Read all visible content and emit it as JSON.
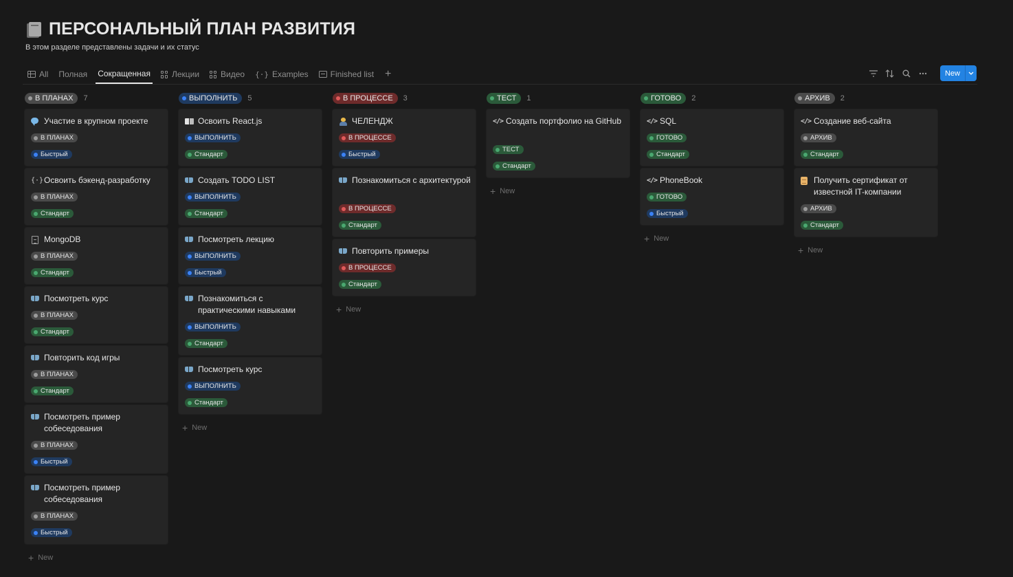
{
  "page": {
    "title": "ПЕРСОНАЛЬНЫЙ ПЛАН РАЗВИТИЯ",
    "subtitle": "В этом разделе представлены задачи и их статус",
    "icon": "books-icon"
  },
  "tabs": [
    {
      "label": "All",
      "icon": "table-icon"
    },
    {
      "label": "Полная",
      "icon": "board-icon"
    },
    {
      "label": "Сокращенная",
      "icon": "board-icon",
      "active": true
    },
    {
      "label": "Лекции",
      "icon": "gallery-icon"
    },
    {
      "label": "Видео",
      "icon": "gallery-icon"
    },
    {
      "label": "Examples",
      "icon": "braces-icon"
    },
    {
      "label": "Finished list",
      "icon": "list-icon"
    }
  ],
  "toolbar": {
    "new_label": "New",
    "icons": [
      "filter-icon",
      "sort-icon",
      "search-icon",
      "more-icon",
      "chevron-down-icon"
    ]
  },
  "colors": {
    "background": "#191919",
    "card": "#252525",
    "accent": "#2383e2",
    "gray_tag": "#4a4a4a",
    "blue_tag": "#1f3a5f",
    "red_tag": "#6e2b2b",
    "green_tag": "#2b5a3a",
    "gray_dot": "#9b9b9b",
    "blue_dot": "#3b82f6",
    "red_dot": "#e05a5a",
    "green_dot": "#4aa870"
  },
  "add_new_label": "New",
  "columns": [
    {
      "status": "В ПЛАНАХ",
      "count": "7",
      "color": "gray",
      "cards": [
        {
          "title": "Участие в крупном проекте",
          "icon": "chat-icon",
          "status": "В ПЛАНАХ",
          "speed": "Быстрый"
        },
        {
          "title": "Освоить бэкенд-разработку",
          "icon": "braces-icon",
          "status": "В ПЛАНАХ",
          "speed": "Стандарт"
        },
        {
          "title": "MongoDB",
          "icon": "document-icon",
          "status": "В ПЛАНАХ",
          "speed": "Стандарт"
        },
        {
          "title": "Посмотреть курс",
          "icon": "book-icon",
          "status": "В ПЛАНАХ",
          "speed": "Стандарт"
        },
        {
          "title": "Повторить код игры",
          "icon": "book-icon",
          "status": "В ПЛАНАХ",
          "speed": "Стандарт"
        },
        {
          "title": "Посмотреть пример собеседования",
          "icon": "book-icon",
          "status": "В ПЛАНАХ",
          "speed": "Быстрый"
        },
        {
          "title": "Посмотреть пример собеседования",
          "icon": "book-icon",
          "status": "В ПЛАНАХ",
          "speed": "Быстрый"
        }
      ]
    },
    {
      "status": "ВЫПОЛНИТЬ",
      "count": "5",
      "color": "blue",
      "cards": [
        {
          "title": "Освоить React.js",
          "icon": "open-book-icon",
          "status": "ВЫПОЛНИТЬ",
          "speed": "Стандарт"
        },
        {
          "title": "Создать TODO LIST",
          "icon": "book-icon",
          "status": "ВЫПОЛНИТЬ",
          "speed": "Стандарт"
        },
        {
          "title": "Посмотреть лекцию",
          "icon": "book-icon",
          "status": "ВЫПОЛНИТЬ",
          "speed": "Быстрый"
        },
        {
          "title": "Познакомиться с практическими навыками",
          "icon": "book-icon",
          "status": "ВЫПОЛНИТЬ",
          "speed": "Стандарт"
        },
        {
          "title": "Посмотреть курс",
          "icon": "book-icon",
          "status": "ВЫПОЛНИТЬ",
          "speed": "Стандарт"
        }
      ]
    },
    {
      "status": "В ПРОЦЕССЕ",
      "count": "3",
      "color": "red",
      "cards": [
        {
          "title": "ЧЕЛЕНДЖ",
          "icon": "person-icon",
          "status": "В ПРОЦЕССЕ",
          "speed": "Быстрый"
        },
        {
          "title": "Познакомиться с архитектурой",
          "icon": "book-icon",
          "status": "В ПРОЦЕССЕ",
          "speed": "Стандарт"
        },
        {
          "title": "Повторить примеры",
          "icon": "book-icon",
          "status": "В ПРОЦЕССЕ",
          "speed": "Стандарт"
        }
      ]
    },
    {
      "status": "ТЕСТ",
      "count": "1",
      "color": "green",
      "cards": [
        {
          "title": "Создать портфолио на GitHub",
          "icon": "code-icon",
          "status": "ТЕСТ",
          "speed": "Стандарт"
        }
      ]
    },
    {
      "status": "ГОТОВО",
      "count": "2",
      "color": "green",
      "cards": [
        {
          "title": "SQL",
          "icon": "code-icon",
          "status": "ГОТОВО",
          "speed": "Стандарт"
        },
        {
          "title": "PhoneBook",
          "icon": "code-icon",
          "status": "ГОТОВО",
          "speed": "Быстрый"
        }
      ]
    },
    {
      "status": "АРХИВ",
      "count": "2",
      "color": "gray",
      "cards": [
        {
          "title": "Создание веб-сайта",
          "icon": "code-icon",
          "status": "АРХИВ",
          "speed": "Стандарт"
        },
        {
          "title": "Получить сертификат от известной IT-компании",
          "icon": "scroll-icon",
          "status": "АРХИВ",
          "speed": "Стандарт"
        }
      ]
    }
  ]
}
